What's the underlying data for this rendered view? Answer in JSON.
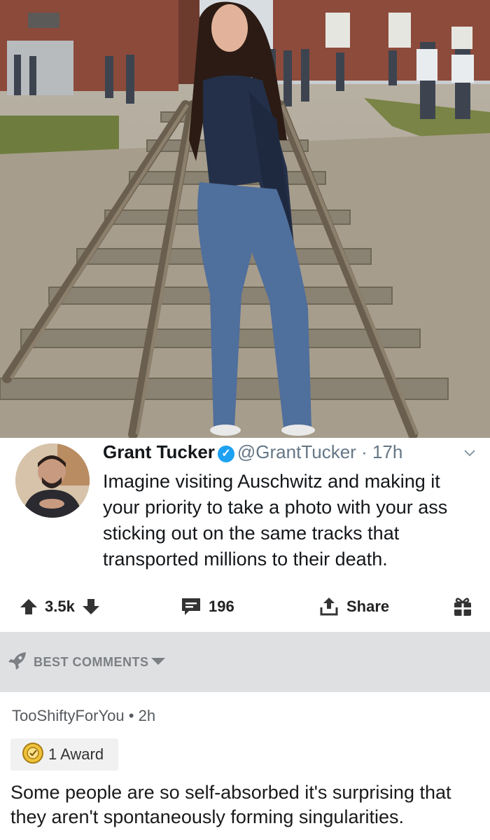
{
  "tweet": {
    "name": "Grant Tucker",
    "handle": "@GrantTucker",
    "separator": "·",
    "time": "17h",
    "text": "Imagine visiting Auschwitz and making it your priority to take a photo with your ass sticking out on the same tracks that transported millions to their death."
  },
  "actions": {
    "upvotes": "3.5k",
    "comments": "196",
    "share_label": "Share"
  },
  "sort": {
    "label": "BEST COMMENTS"
  },
  "comment": {
    "author": "TooShiftyForYou",
    "separator": "•",
    "age": "2h",
    "award_label": "1 Award",
    "body": "Some people are so self-absorbed it's surprising that they aren't spontaneously forming singularities."
  },
  "colors": {
    "verified": "#1da1f2",
    "sort_bar": "#dfe0e2",
    "handle": "#657786"
  }
}
